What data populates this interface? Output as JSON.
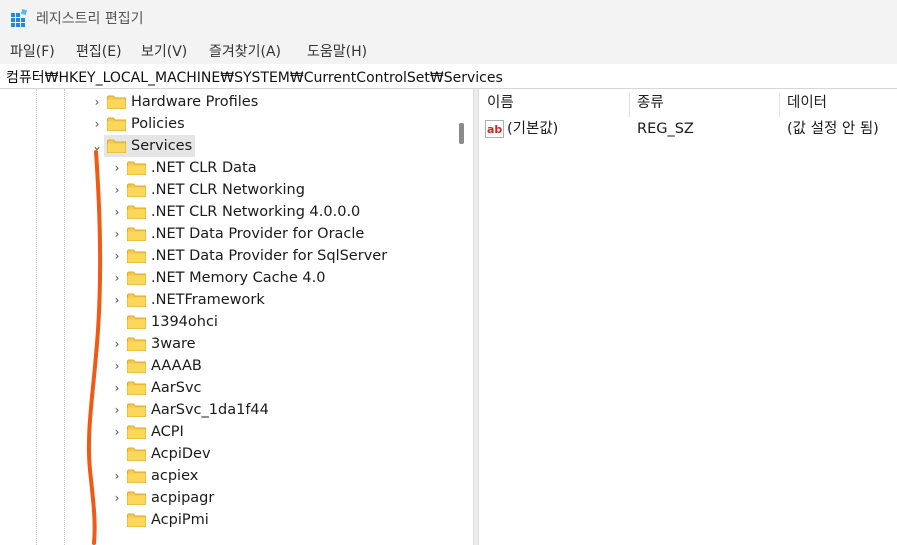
{
  "window": {
    "title": "레지스트리 편집기"
  },
  "menu": [
    "파일(F)",
    "편집(E)",
    "보기(V)",
    "즐겨찾기(A)",
    "도움말(H)"
  ],
  "address": {
    "path": "컴퓨터₩HKEY_LOCAL_MACHINE₩SYSTEM₩CurrentControlSet₩Services"
  },
  "tree": {
    "items": [
      {
        "label": "Hardware Profiles",
        "expander": "›"
      },
      {
        "label": "Policies",
        "expander": "›"
      },
      {
        "label": "Services",
        "expander": "⌄",
        "selected": true
      },
      {
        "label": ".NET CLR Data",
        "expander": "›"
      },
      {
        "label": ".NET CLR Networking",
        "expander": "›"
      },
      {
        "label": ".NET CLR Networking 4.0.0.0",
        "expander": "›"
      },
      {
        "label": ".NET Data Provider for Oracle",
        "expander": "›"
      },
      {
        "label": ".NET Data Provider for SqlServer",
        "expander": "›"
      },
      {
        "label": ".NET Memory Cache 4.0",
        "expander": "›"
      },
      {
        "label": ".NETFramework",
        "expander": "›"
      },
      {
        "label": "1394ohci",
        "expander": ""
      },
      {
        "label": "3ware",
        "expander": "›"
      },
      {
        "label": "AAAAB",
        "expander": "›"
      },
      {
        "label": "AarSvc",
        "expander": "›"
      },
      {
        "label": "AarSvc_1da1f44",
        "expander": "›"
      },
      {
        "label": "ACPI",
        "expander": "›"
      },
      {
        "label": "AcpiDev",
        "expander": ""
      },
      {
        "label": "acpiex",
        "expander": "›"
      },
      {
        "label": "acpipagr",
        "expander": "›"
      },
      {
        "label": "AcpiPmi",
        "expander": ""
      }
    ]
  },
  "list": {
    "headers": {
      "name": "이름",
      "type": "종류",
      "data": "데이터"
    },
    "rows": [
      {
        "name": "(기본값)",
        "type": "REG_SZ",
        "data": "(값 설정 안 됨)",
        "icon": "string-value-icon"
      }
    ]
  },
  "colors": {
    "folder": "#f7c948",
    "folder_dark": "#e0a82e",
    "selection": "#e5e5e5",
    "annotation": "#f05a14",
    "app_icon": "#1e88e5"
  }
}
